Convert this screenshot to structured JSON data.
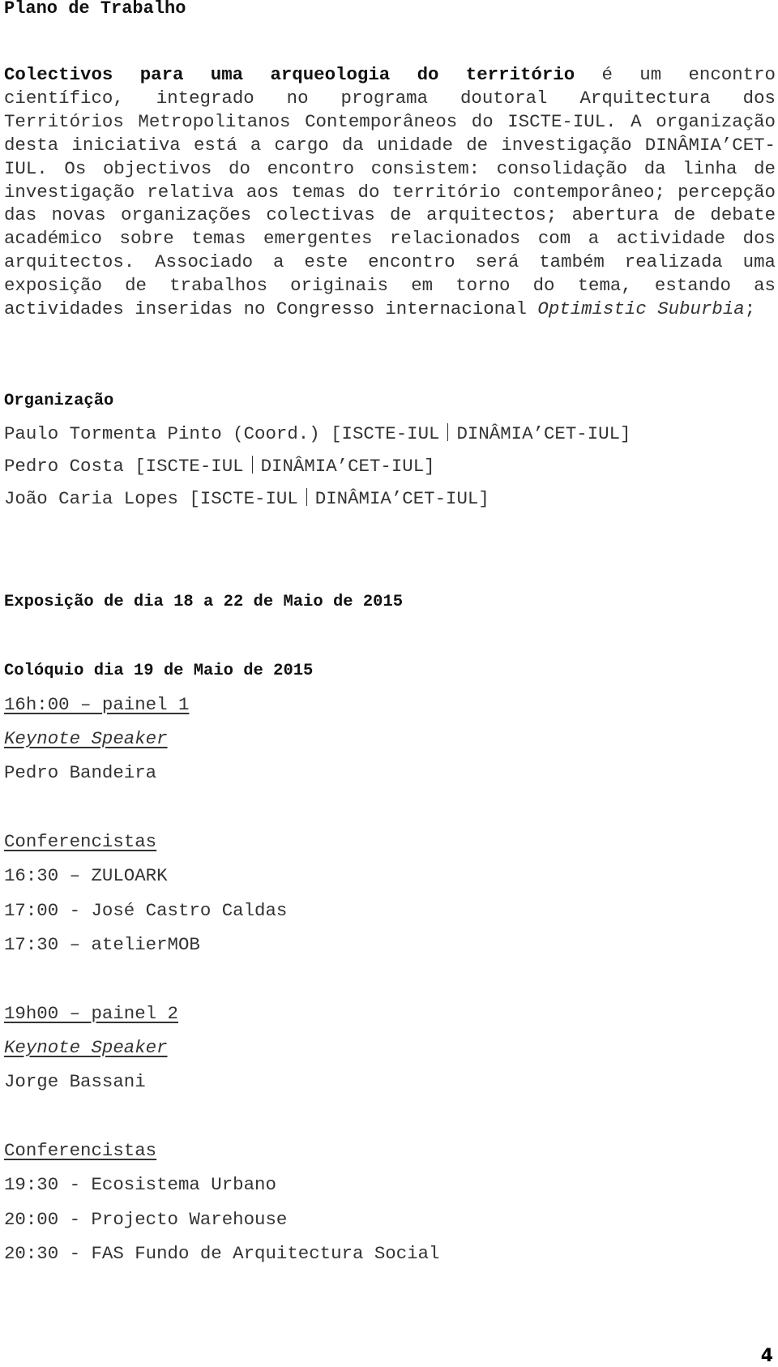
{
  "document": {
    "title": "Plano de Trabalho",
    "intro": {
      "bold_lead": "Colectivos para uma arqueologia do território",
      "text_before_italic": " é um encontro científico, integrado no programa doutoral Arquitectura dos Territórios Metropolitanos Contemporâneos do ISCTE-IUL. A organização desta iniciativa está a cargo da unidade de investigação DINÂMIA’CET-IUL. Os objectivos do encontro consistem: consolidação da linha de investigação relativa aos temas do território contemporâneo; percepção das novas organizações colectivas de arquitectos; abertura de debate académico sobre temas emergentes relacionados com a actividade dos arquitectos. Associado a este encontro será também realizada uma exposição de trabalhos originais em torno do tema, estando as actividades inseridas no Congresso internacional ",
      "italic": "Optimistic Suburbia",
      "text_after_italic": ";"
    },
    "organization": {
      "heading": "Organização",
      "members": [
        {
          "name": "Paulo Tormenta Pinto (Coord.) [ISCTE-IUL",
          "unit": "DINÂMIA’CET-IUL]"
        },
        {
          "name": "Pedro Costa [ISCTE-IUL",
          "unit": "DINÂMIA’CET-IUL]"
        },
        {
          "name": "João Caria Lopes [ISCTE-IUL",
          "unit": "DINÂMIA’CET-IUL]"
        }
      ]
    },
    "exhibition": "Exposição de dia 18 a 22 de Maio de 2015",
    "colloquium": {
      "heading": "Colóquio dia 19 de Maio de 2015",
      "panels": [
        {
          "title": "16h:00 – painel 1",
          "keynote_label": "Keynote Speaker",
          "keynote": "Pedro Bandeira",
          "speakers_label": "Conferencistas",
          "speakers": [
            "16:30 – ZULOARK",
            "17:00 - José Castro Caldas",
            "17:30 – atelierMOB"
          ]
        },
        {
          "title": "19h00 – painel 2",
          "keynote_label": "Keynote Speaker",
          "keynote": "Jorge Bassani",
          "speakers_label": "Conferencistas",
          "speakers": [
            "19:30 - Ecosistema Urbano",
            "20:00 - Projecto Warehouse",
            "20:30 - FAS Fundo de Arquitectura Social"
          ]
        }
      ]
    },
    "page_number": "4"
  }
}
